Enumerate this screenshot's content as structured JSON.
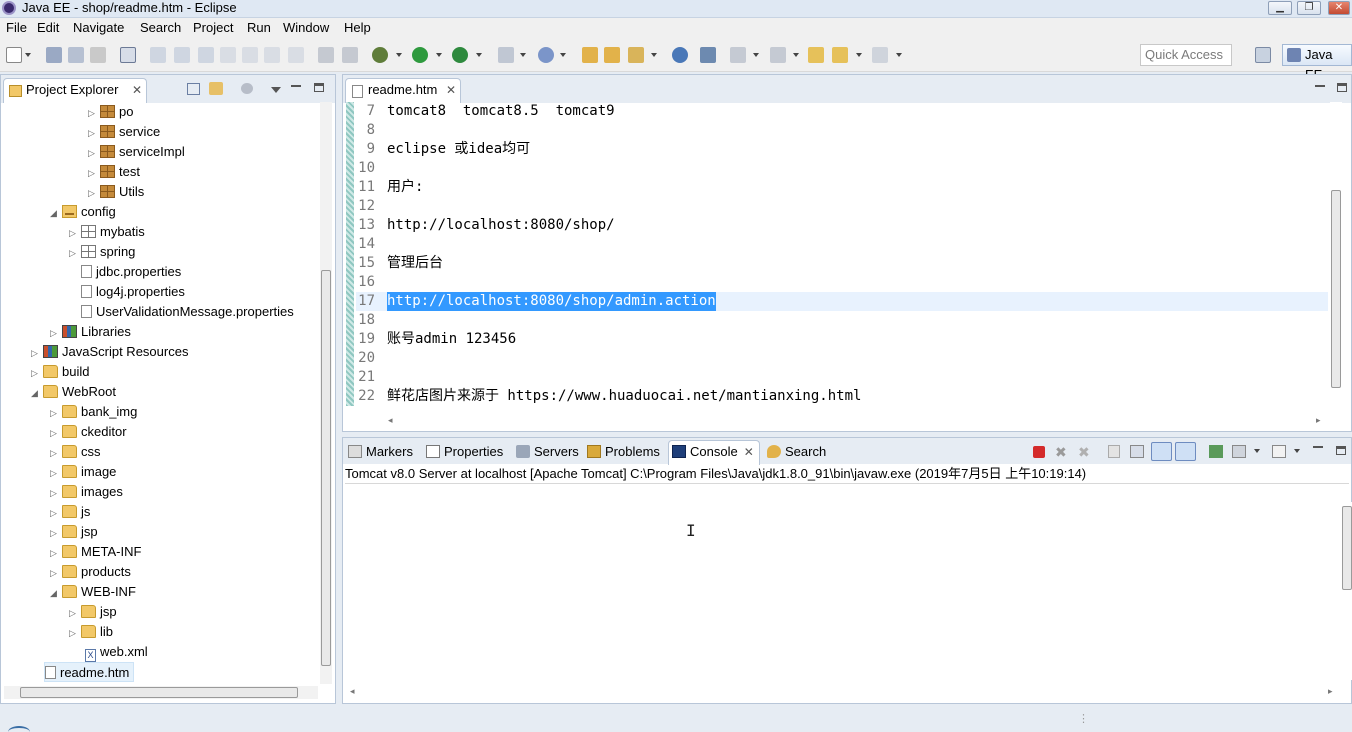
{
  "window": {
    "title": "Java EE - shop/readme.htm - Eclipse"
  },
  "menu": [
    "File",
    "Edit",
    "Navigate",
    "Search",
    "Project",
    "Run",
    "Window",
    "Help"
  ],
  "toolbar": {
    "quick_access": "Quick Access",
    "perspective": "Java EE"
  },
  "explorer": {
    "tab_label": "Project Explorer",
    "items": [
      {
        "label": "po",
        "icon": "package-icon"
      },
      {
        "label": "service",
        "icon": "package-icon"
      },
      {
        "label": "serviceImpl",
        "icon": "package-icon"
      },
      {
        "label": "test",
        "icon": "package-icon"
      },
      {
        "label": "Utils",
        "icon": "package-icon"
      },
      {
        "label": "config",
        "icon": "source-folder-icon"
      },
      {
        "label": "mybatis",
        "icon": "package-icon"
      },
      {
        "label": "spring",
        "icon": "package-icon"
      },
      {
        "label": "jdbc.properties",
        "icon": "file-icon"
      },
      {
        "label": "log4j.properties",
        "icon": "file-icon"
      },
      {
        "label": "UserValidationMessage.properties",
        "icon": "file-icon"
      },
      {
        "label": "Libraries",
        "icon": "library-icon"
      },
      {
        "label": "JavaScript Resources",
        "icon": "library-icon"
      },
      {
        "label": "build",
        "icon": "folder-icon"
      },
      {
        "label": "WebRoot",
        "icon": "folder-icon"
      },
      {
        "label": "bank_img",
        "icon": "folder-icon"
      },
      {
        "label": "ckeditor",
        "icon": "folder-icon"
      },
      {
        "label": "css",
        "icon": "folder-icon"
      },
      {
        "label": "image",
        "icon": "folder-icon"
      },
      {
        "label": "images",
        "icon": "folder-icon"
      },
      {
        "label": "js",
        "icon": "folder-icon"
      },
      {
        "label": "jsp",
        "icon": "folder-icon"
      },
      {
        "label": "META-INF",
        "icon": "folder-icon"
      },
      {
        "label": "products",
        "icon": "folder-icon"
      },
      {
        "label": "WEB-INF",
        "icon": "folder-icon"
      },
      {
        "label": "jsp",
        "icon": "folder-icon"
      },
      {
        "label": "lib",
        "icon": "folder-icon"
      },
      {
        "label": "web.xml",
        "icon": "xml-file-icon"
      },
      {
        "label": "readme.htm",
        "icon": "file-icon"
      }
    ]
  },
  "editor": {
    "tab_label": "readme.htm",
    "lines": [
      {
        "n": "7",
        "text": "tomcat8  tomcat8.5  tomcat9"
      },
      {
        "n": "8",
        "text": ""
      },
      {
        "n": "9",
        "text": "eclipse 或idea均可"
      },
      {
        "n": "10",
        "text": ""
      },
      {
        "n": "11",
        "text": "用户:"
      },
      {
        "n": "12",
        "text": ""
      },
      {
        "n": "13",
        "text": "http://localhost:8080/shop/"
      },
      {
        "n": "14",
        "text": ""
      },
      {
        "n": "15",
        "text": "管理后台"
      },
      {
        "n": "16",
        "text": ""
      },
      {
        "n": "17",
        "text": "http://localhost:8080/shop/admin.action"
      },
      {
        "n": "18",
        "text": ""
      },
      {
        "n": "19",
        "text": "账号admin 123456"
      },
      {
        "n": "20",
        "text": ""
      },
      {
        "n": "21",
        "text": ""
      },
      {
        "n": "22",
        "text": "鲜花店图片来源于 https://www.huaduocai.net/mantianxing.html"
      }
    ]
  },
  "views": {
    "tabs": [
      "Markers",
      "Properties",
      "Servers",
      "Problems",
      "Console",
      "Search"
    ],
    "console_header": "Tomcat v8.0 Server at localhost [Apache Tomcat] C:\\Program Files\\Java\\jdk1.8.0_91\\bin\\javaw.exe (2019年7月5日 上午10:19:14)"
  },
  "colors": {
    "selection": "#3399ff",
    "accent": "#3a6ea5"
  }
}
